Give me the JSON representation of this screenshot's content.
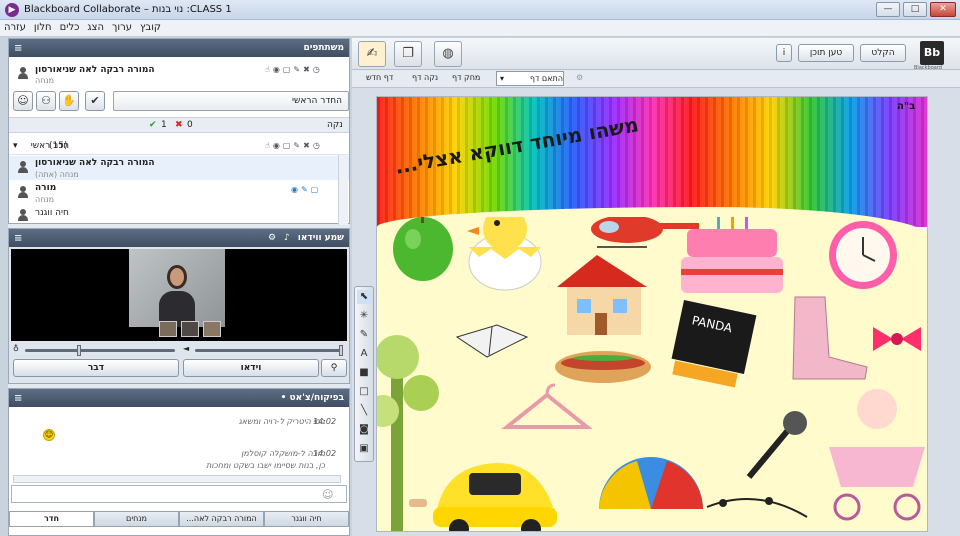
{
  "window": {
    "title": "Blackboard Collaborate – נוי בנות :CLASS 1",
    "minimize": "—",
    "maximize": "□",
    "close": "✕"
  },
  "menu": [
    "קובץ",
    "ערוך",
    "הצג",
    "כלים",
    "חלון",
    "עזרה"
  ],
  "participants_panel": {
    "title": "משתתפים",
    "moderator_name": "המורה רבקה לאה שניאורסון",
    "moderator_role": "מנחה",
    "room_select": "החדר הראשי",
    "vote_label": "נקה",
    "vote_yes": "1",
    "vote_no": "0",
    "section_title": "חדר ראשי",
    "section_count": "(15)",
    "list": [
      {
        "name": "המורה רבקה לאה שניאורסון",
        "role": "מנחה (אתה)"
      },
      {
        "name": "מורה",
        "role": "מנחה"
      },
      {
        "name": "חיה ווגנר",
        "role": ""
      }
    ]
  },
  "video_panel": {
    "title": "שמע ווידאו",
    "talk_button": "דבר",
    "video_button": "וידאו"
  },
  "chat_panel": {
    "title": "• בפיקוח/צ'אט",
    "messages": [
      {
        "time": "14:02",
        "sender": "בסי היטריק ל-רויה ומשאג",
        "text": ""
      },
      {
        "time": "14:02",
        "sender": "מורה ל-מושקלה קוסלמן",
        "text": "כן, בנות שסיימו ישבו בשקט ומחכות"
      }
    ],
    "tabs": [
      "חדר",
      "מנחים",
      "המורה רבקה לאה...",
      "חיה ווגנר"
    ]
  },
  "whiteboard": {
    "logo": "Bb",
    "logo_caption": "Blackboard",
    "record_button": "הקלט",
    "load_button": "טען תוכן",
    "info_button": "i",
    "page_controls": {
      "new_page": "דף חדש",
      "clear_page": "נקה דף",
      "delete_page": "מחק דף",
      "fit_page": "התאם דף"
    },
    "page_number": "ב\"ה",
    "heading": "משהו מיוחד דווקא אצלי..."
  },
  "colors": {
    "title_bar": "#c7d6ea",
    "panel_header": "#4b5a6e",
    "canvas_cream": "#fffbcc",
    "accent_purple": "#7a2b8f"
  }
}
